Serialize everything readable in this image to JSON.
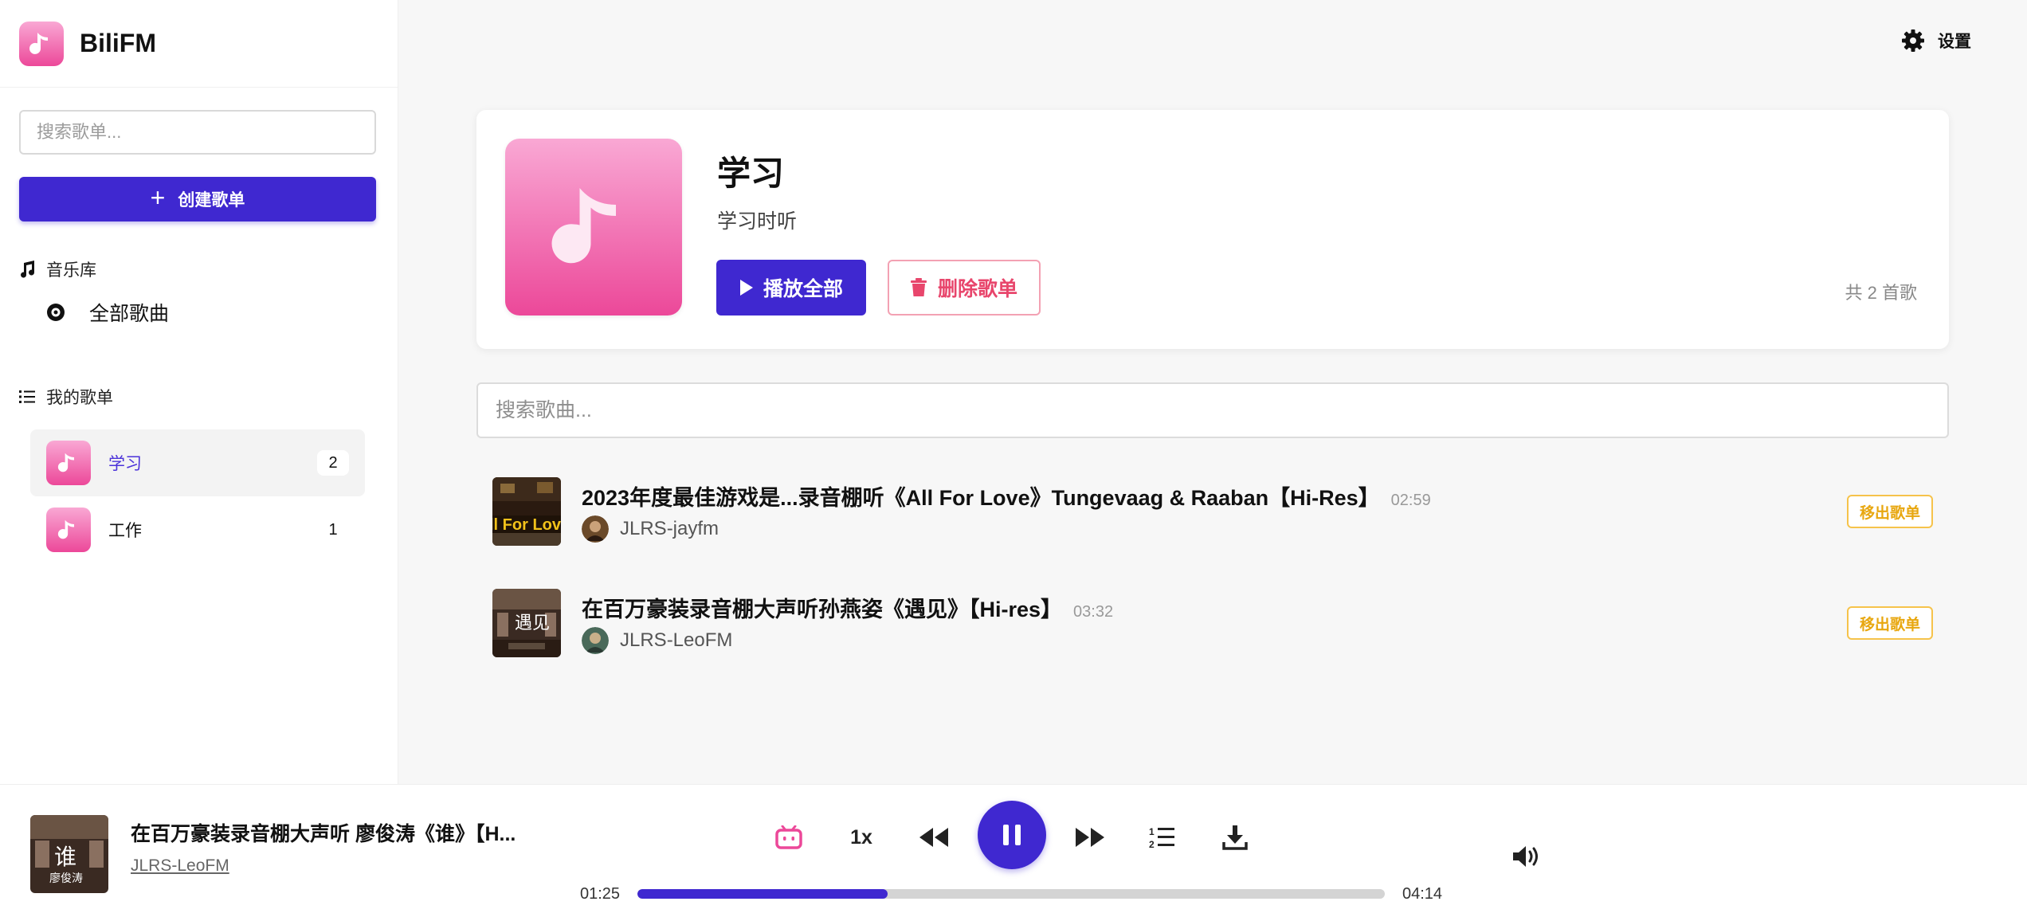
{
  "app": {
    "name": "BiliFM"
  },
  "sidebar": {
    "search_placeholder": "搜索歌单...",
    "create_label": "创建歌单",
    "library_heading": "音乐库",
    "library_items": [
      {
        "label": "全部歌曲",
        "icon": "disc-icon"
      }
    ],
    "playlists_heading": "我的歌单",
    "playlists": [
      {
        "name": "学习",
        "count": "2",
        "active": true
      },
      {
        "name": "工作",
        "count": "1",
        "active": false
      }
    ]
  },
  "header": {
    "settings_label": "设置"
  },
  "playlist": {
    "title": "学习",
    "description": "学习时听",
    "play_all_label": "播放全部",
    "delete_label": "删除歌单",
    "total_label": "共 2 首歌",
    "song_search_placeholder": "搜索歌曲..."
  },
  "songs": [
    {
      "title": "2023年度最佳游戏是...录音棚听《All For Love》Tungevaag & Raaban【Hi-Res】",
      "duration": "02:59",
      "artist": "JLRS-jayfm",
      "remove_label": "移出歌单"
    },
    {
      "title": "在百万豪装录音棚大声听孙燕姿《遇见》【Hi-res】",
      "duration": "03:32",
      "artist": "JLRS-LeoFM",
      "remove_label": "移出歌单"
    }
  ],
  "player": {
    "title": "在百万豪装录音棚大声听 廖俊涛《谁》【H...",
    "artist": "JLRS-LeoFM",
    "speed": "1x",
    "current_time": "01:25",
    "total_time": "04:14",
    "progress": 0.335,
    "icons": [
      "bilibili-icon",
      "rewind-icon",
      "pause-icon",
      "fast-forward-icon",
      "playlist-icon",
      "download-icon",
      "volume-icon"
    ]
  },
  "colors": {
    "accent": "#3f28d0",
    "pink": "#ec4899",
    "danger": "#e8466c",
    "warning": "#e8a70f"
  }
}
